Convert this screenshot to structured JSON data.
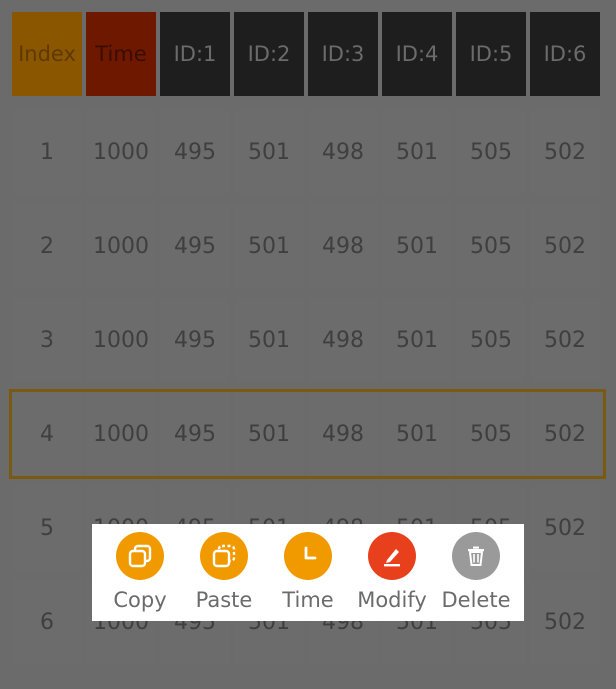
{
  "table": {
    "headers": [
      "Index",
      "Time",
      "ID:1",
      "ID:2",
      "ID:3",
      "ID:4",
      "ID:5",
      "ID:6"
    ],
    "rows": [
      [
        "1",
        "1000",
        "495",
        "501",
        "498",
        "501",
        "505",
        "502"
      ],
      [
        "2",
        "1000",
        "495",
        "501",
        "498",
        "501",
        "505",
        "502"
      ],
      [
        "3",
        "1000",
        "495",
        "501",
        "498",
        "501",
        "505",
        "502"
      ],
      [
        "4",
        "1000",
        "495",
        "501",
        "498",
        "501",
        "505",
        "502"
      ],
      [
        "5",
        "1000",
        "495",
        "501",
        "498",
        "501",
        "505",
        "502"
      ],
      [
        "6",
        "1000",
        "495",
        "501",
        "498",
        "501",
        "505",
        "502"
      ]
    ],
    "selected_row": "4"
  },
  "popup": {
    "actions": [
      {
        "label": "Copy",
        "icon": "copy-icon",
        "color": "#f19a00"
      },
      {
        "label": "Paste",
        "icon": "paste-icon",
        "color": "#f19a00"
      },
      {
        "label": "Time",
        "icon": "clock-icon",
        "color": "#f19a00"
      },
      {
        "label": "Modify",
        "icon": "edit-icon",
        "color": "#e8401c"
      },
      {
        "label": "Delete",
        "icon": "trash-icon",
        "color": "#9a9a9a"
      }
    ]
  },
  "colors": {
    "overlay": "#6b6b6b",
    "accent_orange": "#f19a00",
    "accent_red": "#e8401c",
    "selection_border": "#7a5a10"
  }
}
